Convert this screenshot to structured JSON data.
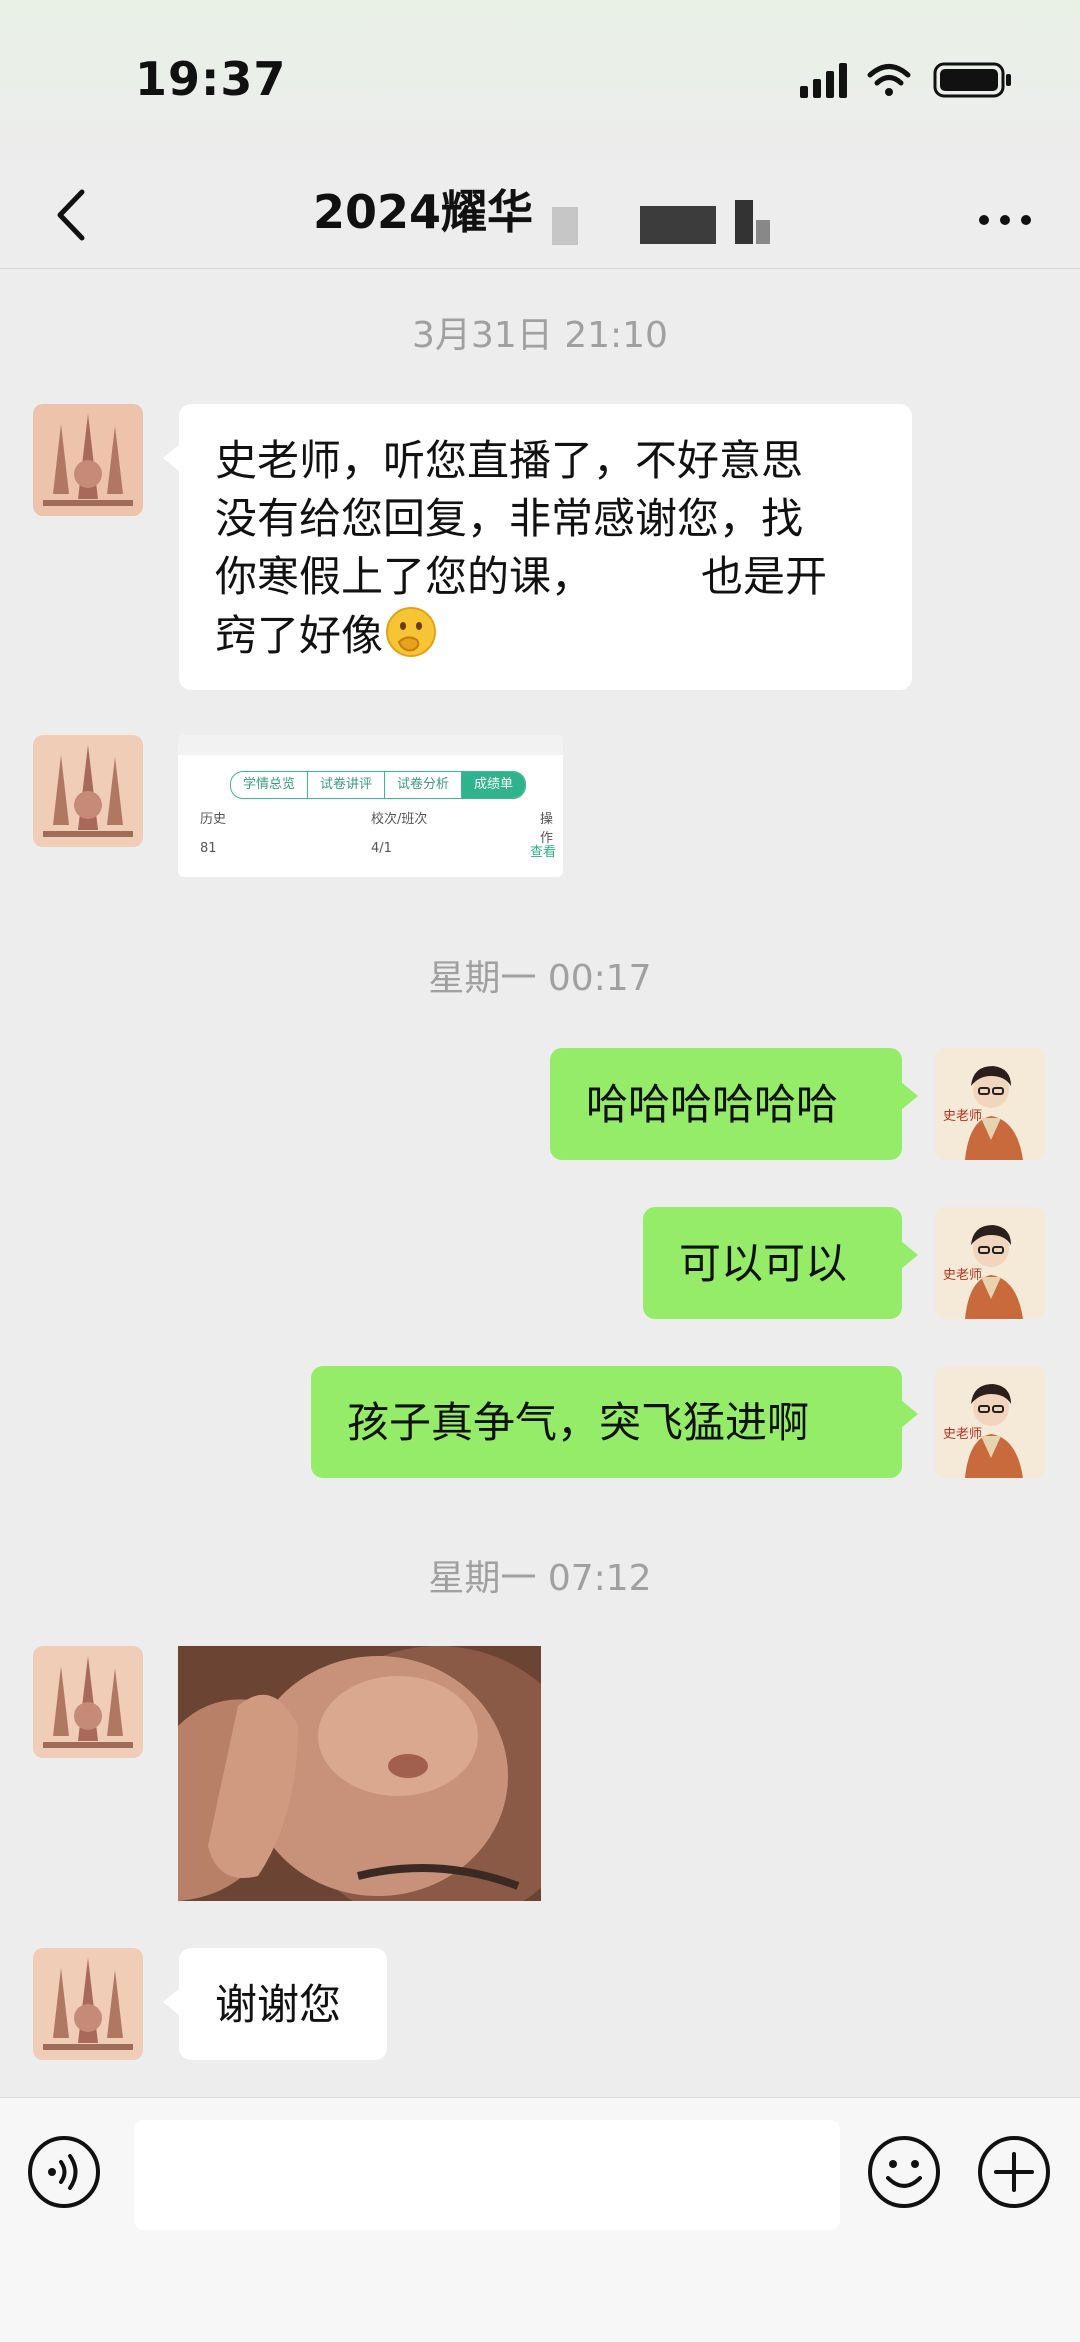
{
  "status_bar": {
    "time": "19:37",
    "signal_icon": "signal-bars-icon",
    "wifi_icon": "wifi-icon",
    "battery_icon": "battery-icon"
  },
  "header": {
    "title": "2024耀华",
    "back_icon": "chevron-left-icon",
    "more_icon": "more-dots-icon"
  },
  "messages": {
    "ts1": "3月31日 21:10",
    "m1_l1": "史老师，听您直播了，不好意思",
    "m1_l2": "没有给您回复，非常感谢您，找",
    "m1_l3a": "你寒假上了您的课，",
    "m1_l3b": "也是开",
    "m1_l4": "窍了好像",
    "m1_emoji": "thinking-face-emoji",
    "score_card": {
      "tabs": [
        "学情总览",
        "试卷讲评",
        "试卷分析",
        "成绩单"
      ],
      "col1": "历史",
      "col2": "校次/班次",
      "col3": "操作",
      "score": "81",
      "rank": "4/1",
      "action": "查看"
    },
    "ts2": "星期一 00:17",
    "m2": "哈哈哈哈哈哈",
    "m3": "可以可以",
    "m4": "孩子真争气，突飞猛进啊",
    "teacher_avatar_label": "史老师",
    "ts3": "星期一 07:12",
    "m6": "谢谢您"
  },
  "input_bar": {
    "voice_icon": "voice-icon",
    "emoji_icon": "smiley-icon",
    "plus_icon": "plus-circle-icon"
  },
  "colors": {
    "background": "#ededed",
    "outgoing_bubble": "#95ec69",
    "incoming_bubble": "#ffffff",
    "accent": "#30b38c"
  }
}
